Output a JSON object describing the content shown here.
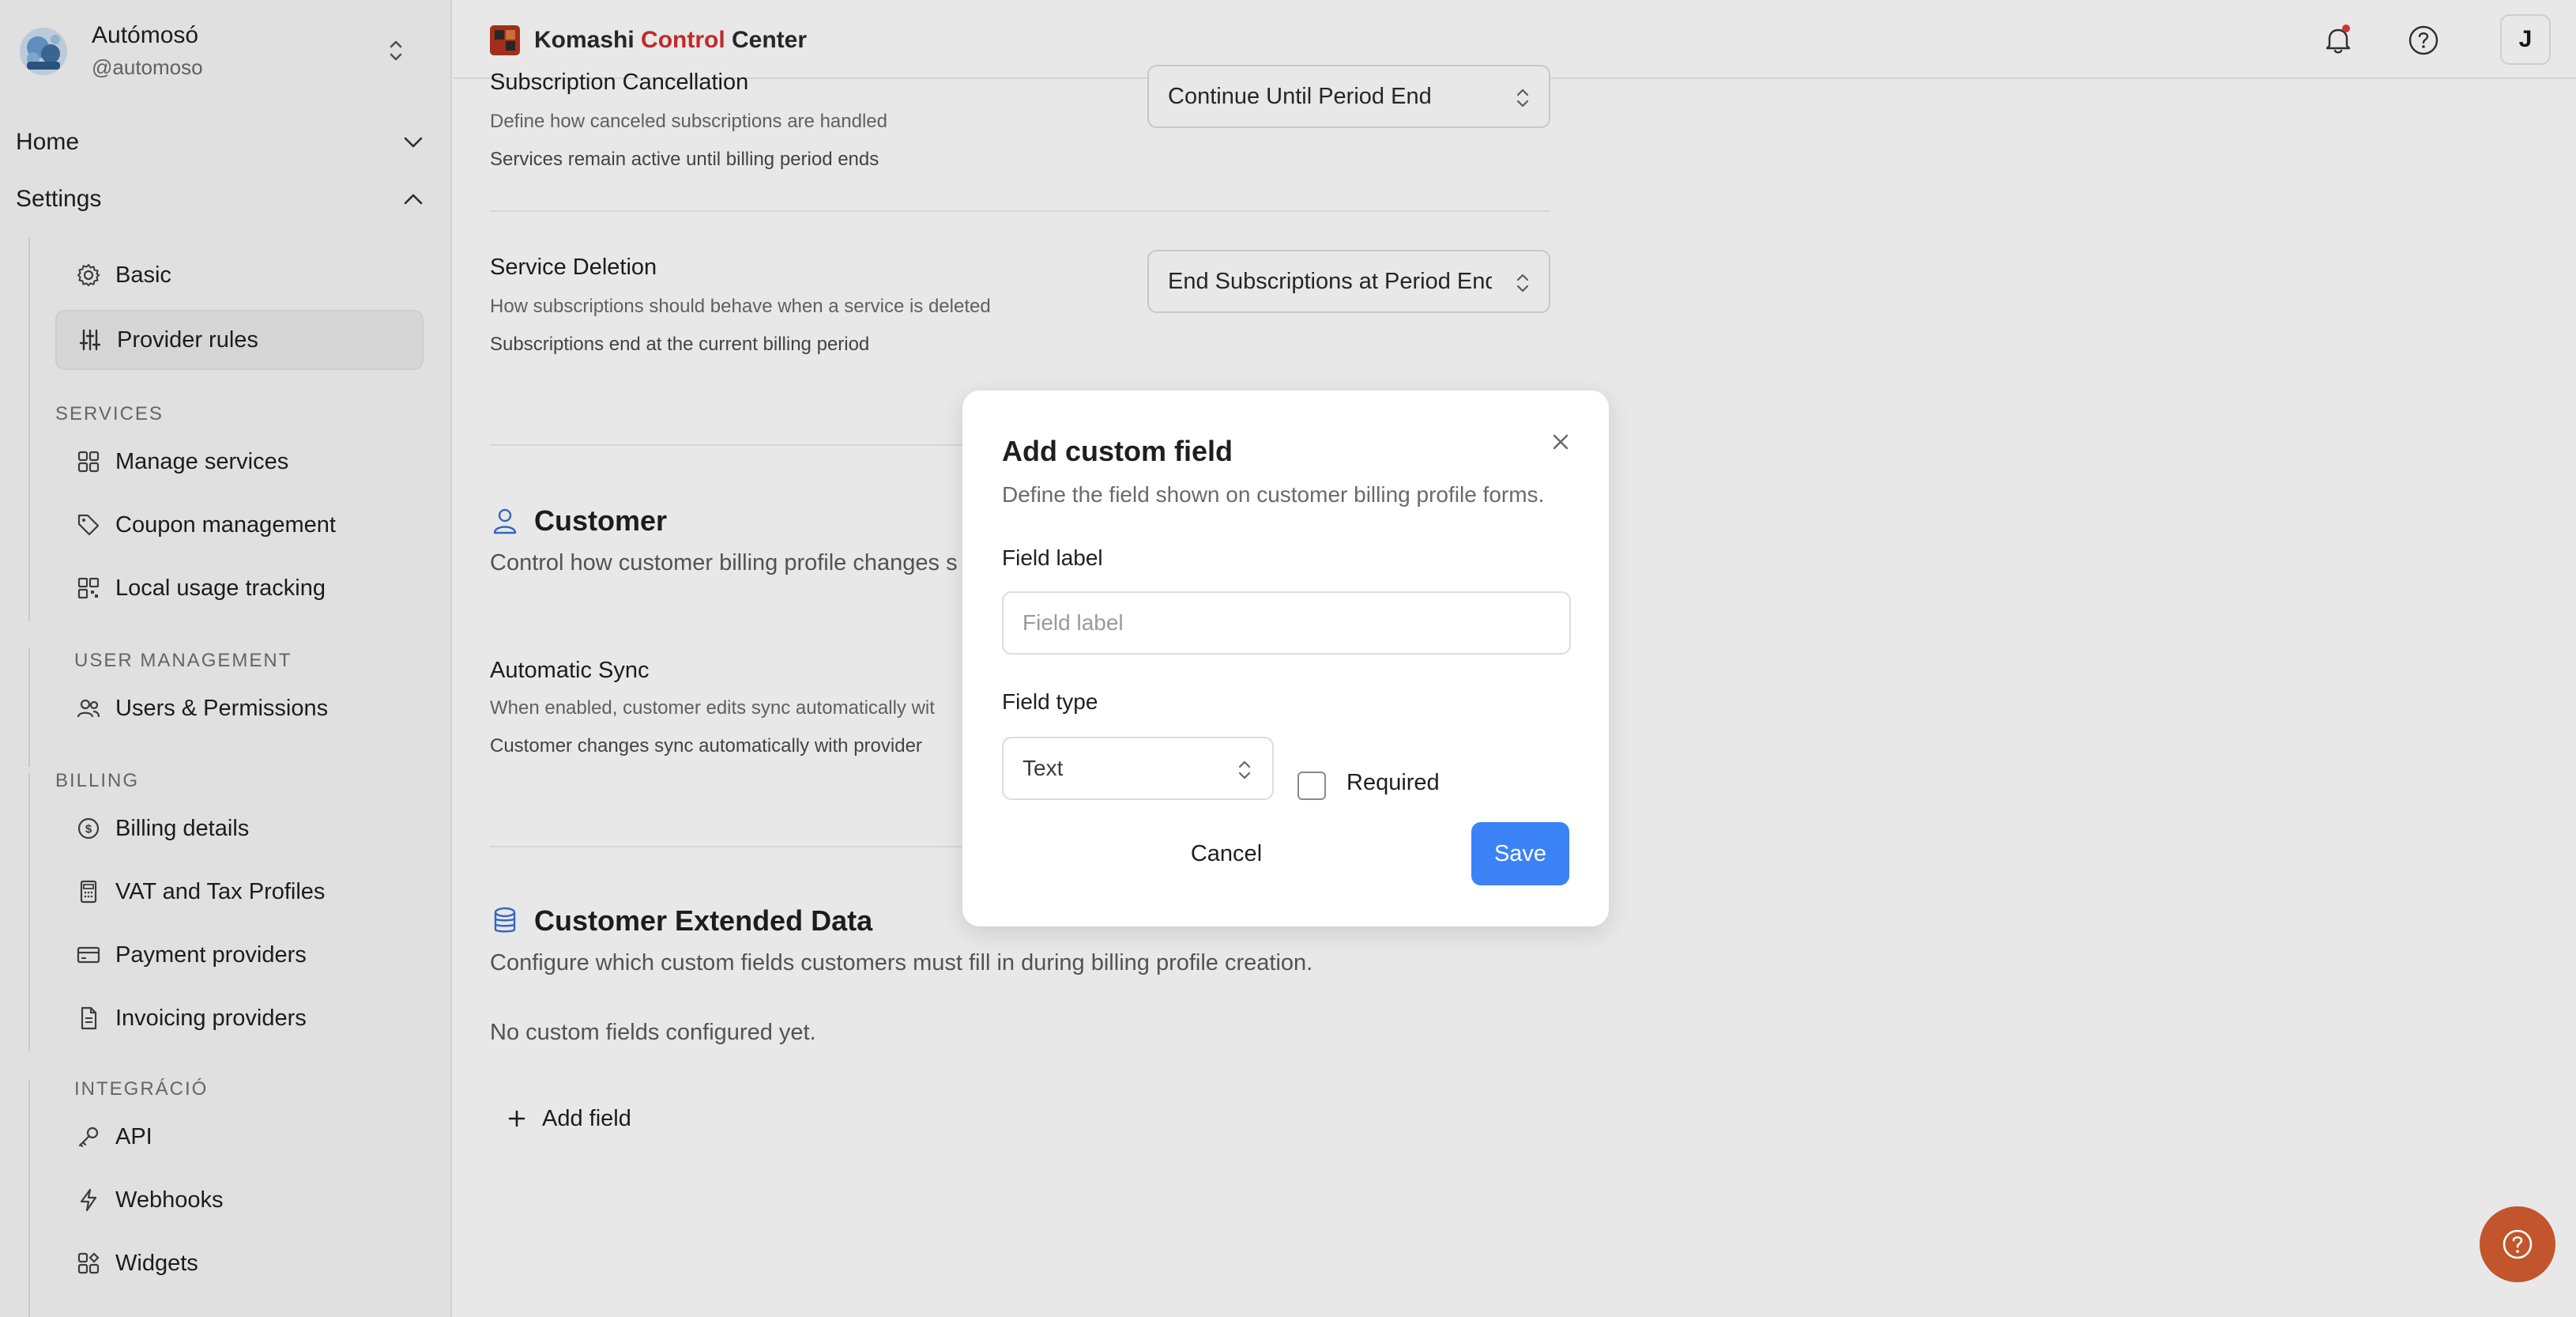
{
  "account": {
    "name": "Autómosó",
    "handle": "@automoso"
  },
  "nav": {
    "home": "Home",
    "settings": "Settings"
  },
  "sidebar": {
    "settings_items": [
      {
        "label": "Basic",
        "icon": "gear-icon"
      },
      {
        "label": "Provider rules",
        "icon": "sliders-icon",
        "active": true
      }
    ],
    "sections": {
      "services": "SERVICES",
      "user_management": "USER MANAGEMENT",
      "billing": "BILLING",
      "integration": "INTEGRÁCIÓ"
    },
    "services_items": [
      {
        "label": "Manage services",
        "icon": "grid-icon"
      },
      {
        "label": "Coupon management",
        "icon": "tag-icon"
      },
      {
        "label": "Local usage tracking",
        "icon": "qr-icon"
      }
    ],
    "user_items": [
      {
        "label": "Users & Permissions",
        "icon": "users-icon"
      }
    ],
    "billing_items": [
      {
        "label": "Billing details",
        "icon": "dollar-circle-icon"
      },
      {
        "label": "VAT and Tax Profiles",
        "icon": "calculator-icon"
      },
      {
        "label": "Payment providers",
        "icon": "credit-card-icon"
      },
      {
        "label": "Invoicing providers",
        "icon": "document-icon"
      }
    ],
    "integration_items": [
      {
        "label": "API",
        "icon": "key-icon"
      },
      {
        "label": "Webhooks",
        "icon": "lightning-icon"
      },
      {
        "label": "Widgets",
        "icon": "widgets-icon"
      }
    ]
  },
  "topbar": {
    "brand_part1": "Komashi ",
    "brand_part2": "Control",
    "brand_part3": " Center",
    "user_initial": "J"
  },
  "main": {
    "subscription_cancellation": {
      "title": "Subscription Cancellation",
      "desc": "Define how canceled subscriptions are handled",
      "status": "Services remain active until billing period ends",
      "select_value": "Continue Until Period End"
    },
    "service_deletion": {
      "title": "Service Deletion",
      "desc": "How subscriptions should behave when a service is deleted",
      "status": "Subscriptions end at the current billing period",
      "select_value": "End Subscriptions at Period End"
    },
    "customer": {
      "title": "Customer",
      "desc": "Control how customer billing profile changes s"
    },
    "automatic_sync": {
      "title": "Automatic Sync",
      "desc": "When enabled, customer edits sync automatically wit",
      "status": "Customer changes sync automatically with provider"
    },
    "customer_extended": {
      "title": "Customer Extended Data",
      "desc": "Configure which custom fields customers must fill in during billing profile creation.",
      "empty": "No custom fields configured yet.",
      "add_label": "Add field"
    }
  },
  "modal": {
    "title": "Add custom field",
    "desc": "Define the field shown on customer billing profile forms.",
    "field_label_label": "Field label",
    "field_label_placeholder": "Field label",
    "field_label_value": "",
    "field_type_label": "Field type",
    "field_type_value": "Text",
    "required_label": "Required",
    "required_checked": false,
    "cancel": "Cancel",
    "save": "Save"
  },
  "colors": {
    "accent": "#3b82f6",
    "brand_red": "#d32f2f",
    "help_fab": "#c2552b"
  }
}
